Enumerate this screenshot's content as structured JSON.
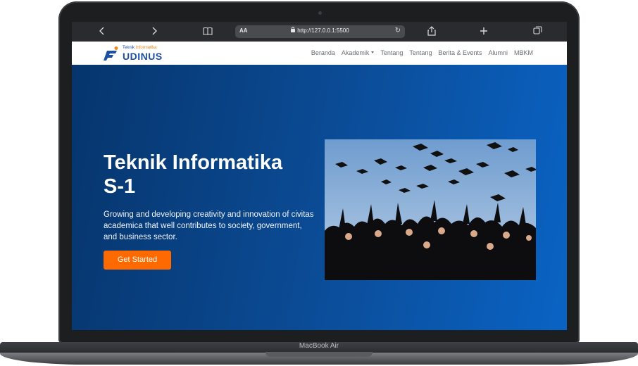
{
  "device": {
    "label": "MacBook Air"
  },
  "browser": {
    "text_size_button": "AA",
    "url": "http://127.0.0.1:5500",
    "icons": [
      "back-icon",
      "forward-icon",
      "reader-icon",
      "reload-icon",
      "share-icon",
      "new-tab-icon",
      "tabs-icon"
    ]
  },
  "site": {
    "logo": {
      "small_left": "Teknik",
      "small_right": "Informatika",
      "main": "UDINUS"
    },
    "nav": [
      {
        "label": "Beranda"
      },
      {
        "label": "Akademik",
        "has_dropdown": true
      },
      {
        "label": "Tentang"
      },
      {
        "label": "Tentang"
      },
      {
        "label": "Berita & Events"
      },
      {
        "label": "Alumni"
      },
      {
        "label": "MBKM"
      }
    ],
    "hero": {
      "title": "Teknik Informatika S-1",
      "description": "Growing and developing creativity and innovation of civitas academica that well contributes to society, government, and business sector.",
      "cta": "Get Started"
    }
  },
  "colors": {
    "accent": "#ff6a00",
    "brand_blue": "#1e4fa3",
    "hero_dark": "#06356c",
    "hero_light": "#0a63c4"
  }
}
